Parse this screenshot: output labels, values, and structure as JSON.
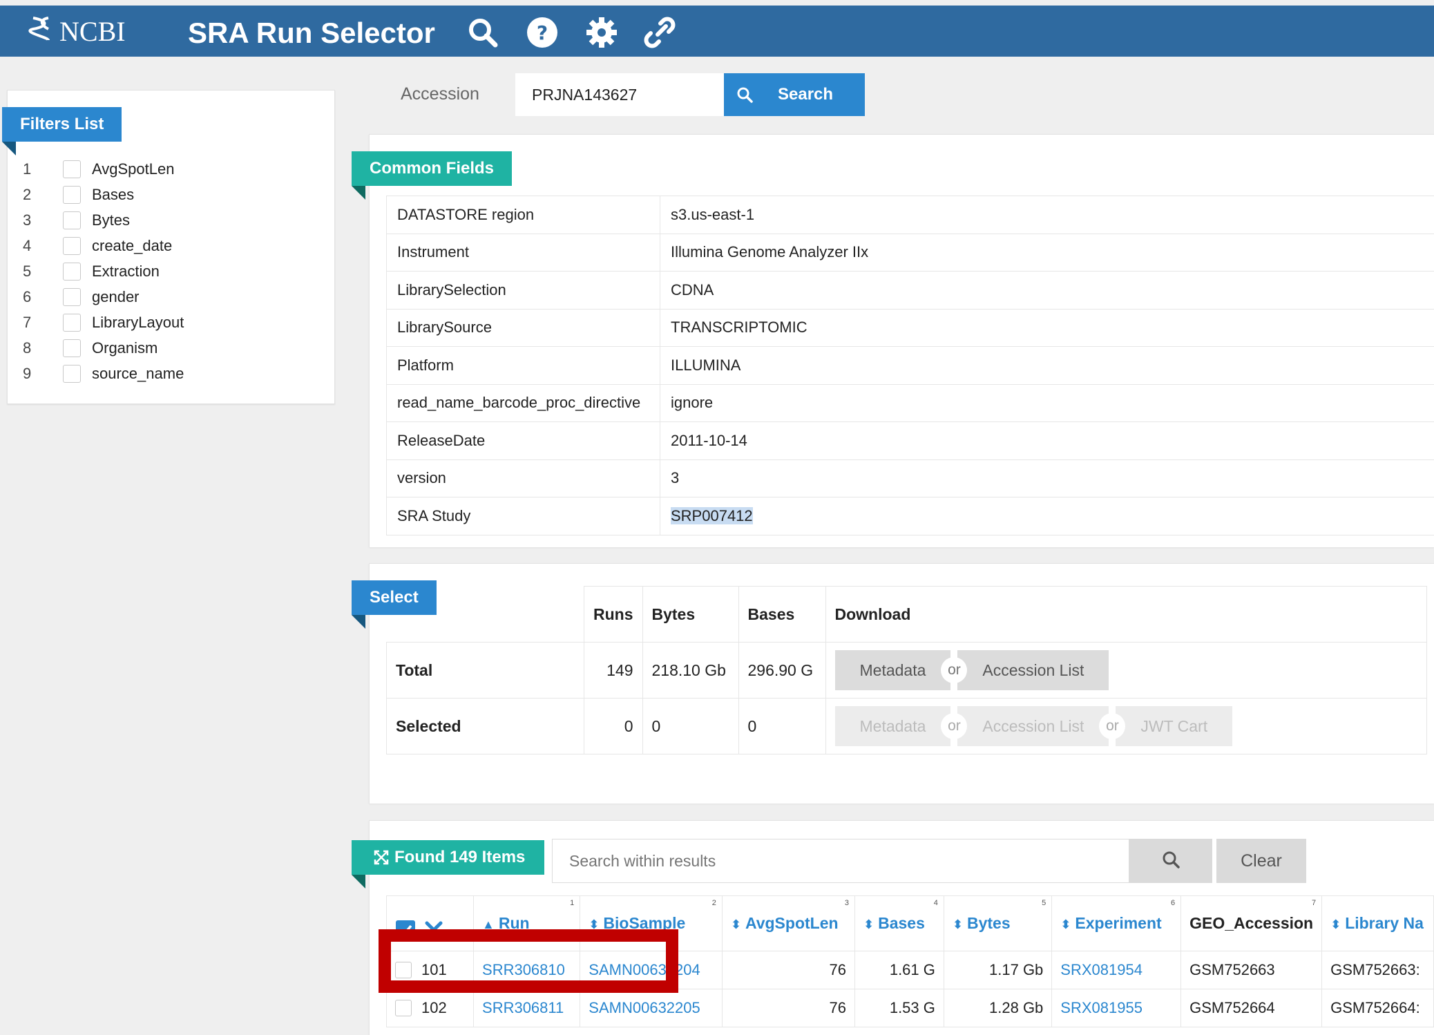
{
  "header": {
    "logo_text": "NCBI",
    "app_title": "SRA Run Selector",
    "icons": [
      "search-icon",
      "help-icon",
      "settings-icon",
      "link-icon"
    ]
  },
  "filters": {
    "title": "Filters List",
    "items": [
      {
        "num": "1",
        "label": "AvgSpotLen"
      },
      {
        "num": "2",
        "label": "Bases"
      },
      {
        "num": "3",
        "label": "Bytes"
      },
      {
        "num": "4",
        "label": "create_date"
      },
      {
        "num": "5",
        "label": "Extraction"
      },
      {
        "num": "6",
        "label": "gender"
      },
      {
        "num": "7",
        "label": "LibraryLayout"
      },
      {
        "num": "8",
        "label": "Organism"
      },
      {
        "num": "9",
        "label": "source_name"
      }
    ]
  },
  "accession": {
    "label": "Accession",
    "value": "PRJNA143627",
    "button": "Search"
  },
  "common_fields": {
    "title": "Common Fields",
    "rows": [
      {
        "key": "DATASTORE region",
        "value": "s3.us-east-1"
      },
      {
        "key": "Instrument",
        "value": "Illumina Genome Analyzer IIx"
      },
      {
        "key": "LibrarySelection",
        "value": "CDNA"
      },
      {
        "key": "LibrarySource",
        "value": "TRANSCRIPTOMIC"
      },
      {
        "key": "Platform",
        "value": "ILLUMINA"
      },
      {
        "key": "read_name_barcode_proc_directive",
        "value": "ignore"
      },
      {
        "key": "ReleaseDate",
        "value": "2011-10-14"
      },
      {
        "key": "version",
        "value": "3"
      },
      {
        "key": "SRA Study",
        "value": "SRP007412"
      }
    ]
  },
  "select": {
    "title": "Select",
    "headers": {
      "runs": "Runs",
      "bytes": "Bytes",
      "bases": "Bases",
      "download": "Download"
    },
    "total": {
      "label": "Total",
      "runs": "149",
      "bytes": "218.10 Gb",
      "bases": "296.90 G"
    },
    "selected": {
      "label": "Selected",
      "runs": "0",
      "bytes": "0",
      "bases": "0"
    },
    "buttons": {
      "metadata": "Metadata",
      "or": "or",
      "accession_list": "Accession List",
      "jwt_cart": "JWT Cart"
    }
  },
  "found": {
    "title": "Found 149 Items",
    "search_placeholder": "Search within results",
    "clear": "Clear",
    "columns": [
      {
        "label": "Run",
        "num": "1"
      },
      {
        "label": "BioSample",
        "num": "2"
      },
      {
        "label": "AvgSpotLen",
        "num": "3"
      },
      {
        "label": "Bases",
        "num": "4"
      },
      {
        "label": "Bytes",
        "num": "5"
      },
      {
        "label": "Experiment",
        "num": "6"
      },
      {
        "label": "GEO_Accession",
        "num": "7"
      },
      {
        "label": "Library Na",
        "num": ""
      }
    ],
    "rows": [
      {
        "idx": "101",
        "run": "SRR306810",
        "biosample": "SAMN00632204",
        "avgspotlen": "76",
        "bases": "1.61 G",
        "bytes": "1.17 Gb",
        "experiment": "SRX081954",
        "geo": "GSM752663",
        "library": "GSM752663:"
      },
      {
        "idx": "102",
        "run": "SRR306811",
        "biosample": "SAMN00632205",
        "avgspotlen": "76",
        "bases": "1.53 G",
        "bytes": "1.28 Gb",
        "experiment": "SRX081955",
        "geo": "GSM752664",
        "library": "GSM752664:"
      }
    ]
  },
  "colors": {
    "header": "#2f6aa0",
    "accent": "#2b87cf",
    "teal": "#1fb3a3",
    "highlight_box": "#c00000"
  }
}
